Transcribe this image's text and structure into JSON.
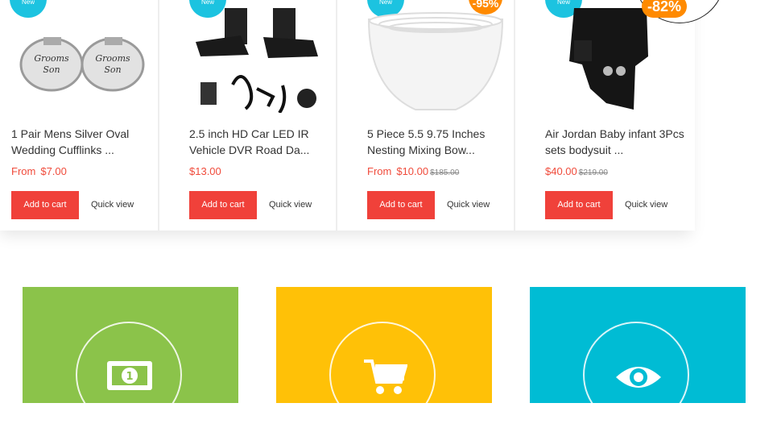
{
  "products": [
    {
      "badge": "New",
      "name_line1": "1 Pair Mens Silver Oval",
      "name_line2": "Wedding Cufflinks ...",
      "from": "From",
      "price": "$7.00",
      "old_price": "",
      "add_to_cart": "Add to cart",
      "quick_view": "Quick view"
    },
    {
      "badge": "New",
      "name_line1": "2.5 inch HD Car LED IR",
      "name_line2": "Vehicle DVR Road Da...",
      "from": "",
      "price": "$13.00",
      "old_price": "",
      "add_to_cart": "Add to cart",
      "quick_view": "Quick view"
    },
    {
      "badge": "New",
      "discount": "-95%",
      "name_line1": "5 Piece 5.5 9.75 Inches",
      "name_line2": "Nesting Mixing Bow...",
      "from": "From",
      "price": "$10.00",
      "old_price": "$185.00",
      "add_to_cart": "Add to cart",
      "quick_view": "Quick view"
    },
    {
      "badge": "New",
      "discount": "-82%",
      "name_line1": "Air Jordan Baby infant 3Pcs",
      "name_line2": "sets bodysuit ...",
      "from": "",
      "price": "$40.00",
      "old_price": "$219.00",
      "add_to_cart": "Add to cart",
      "quick_view": "Quick view"
    }
  ],
  "features": [
    {
      "color": "#8bc34a",
      "icon": "money-icon"
    },
    {
      "color": "#ffc107",
      "icon": "cart-icon"
    },
    {
      "color": "#00bcd4",
      "icon": "eye-icon"
    }
  ],
  "colors": {
    "accent": "#f0413a",
    "badge_new": "#1cc3e0",
    "badge_discount": "#ff8a00"
  }
}
